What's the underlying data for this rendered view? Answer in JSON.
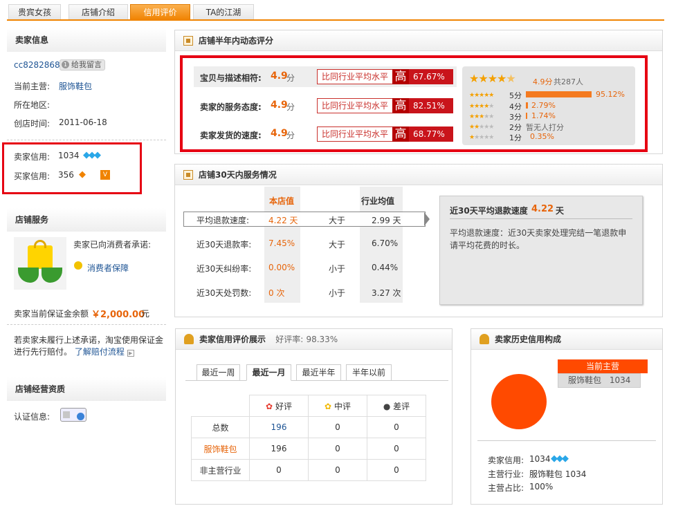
{
  "tabs": [
    "贵宾女孩",
    "店铺介绍",
    "信用评价",
    "TA的江湖"
  ],
  "seller_info": {
    "title": "卖家信息",
    "name": "cc8282868",
    "message_btn": "给我留言",
    "main_label": "当前主营:",
    "main_value": "服饰鞋包",
    "region_label": "所在地区:",
    "created_label": "创店时间:",
    "created_value": "2011-06-18",
    "seller_credit_label": "卖家信用:",
    "seller_credit_value": "1034",
    "buyer_credit_label": "买家信用:",
    "buyer_credit_value": "356"
  },
  "store_service": {
    "title": "店铺服务",
    "promise": "卖家已向消费者承诺:",
    "guarantee": "消费者保障",
    "deposit_label": "卖家当前保证金余额",
    "deposit_value": "￥2,000.00",
    "deposit_unit": "元",
    "note": "若卖家未履行上述承诺，淘宝使用保证金进行先行赔付。",
    "note_link": "了解赔付流程"
  },
  "qualification": {
    "title": "店铺经营资质",
    "label": "认证信息:"
  },
  "dsr": {
    "title": "店铺半年内动态评分",
    "rows": [
      {
        "label": "宝贝与描述相符:",
        "score": "4.9",
        "unit": "分",
        "cmp": "比同行业平均水平",
        "level": "高",
        "pct": "67.67%"
      },
      {
        "label": "卖家的服务态度:",
        "score": "4.9",
        "unit": "分",
        "cmp": "比同行业平均水平",
        "level": "高",
        "pct": "82.51%"
      },
      {
        "label": "卖家发货的速度:",
        "score": "4.9",
        "unit": "分",
        "cmp": "比同行业平均水平",
        "level": "高",
        "pct": "68.77%"
      }
    ],
    "summary_score": "4.9分",
    "summary_count": "共287人",
    "distribution": [
      {
        "label": "5分",
        "pct": "95.12%",
        "fill": 0.9512
      },
      {
        "label": "4分",
        "pct": "2.79%",
        "fill": 0.0279
      },
      {
        "label": "3分",
        "pct": "1.74%",
        "fill": 0.0174
      },
      {
        "label": "2分",
        "pct": "暂无人打分",
        "fill": 0
      },
      {
        "label": "1分",
        "pct": "0.35%",
        "fill": 0.0035
      }
    ]
  },
  "service30": {
    "title": "店铺30天内服务情况",
    "col_store": "本店值",
    "col_industry": "行业均值",
    "rows": [
      {
        "label": "平均退款速度:",
        "store": "4.22 天",
        "cmp": "大于",
        "industry": "2.99 天"
      },
      {
        "label": "近30天退款率:",
        "store": "7.45%",
        "cmp": "大于",
        "industry": "6.70%"
      },
      {
        "label": "近30天纠纷率:",
        "store": "0.00%",
        "cmp": "小于",
        "industry": "0.44%"
      },
      {
        "label": "近30天处罚数:",
        "store": "0 次",
        "cmp": "小于",
        "industry": "3.27 次"
      }
    ],
    "tip_title": "近30天平均退款速度",
    "tip_value": "4.22",
    "tip_unit": "天",
    "tip_desc": "平均退款速度：近30天卖家处理完结一笔退款申请平均花费的时长。"
  },
  "reviews": {
    "title": "卖家信用评价展示",
    "rate_label": "好评率:",
    "rate_value": "98.33%",
    "tabs": [
      "最近一周",
      "最近一月",
      "最近半年",
      "半年以前"
    ],
    "headers": [
      "好评",
      "中评",
      "差评"
    ],
    "rows": [
      {
        "label": "总数",
        "values": [
          "196",
          "0",
          "0"
        ]
      },
      {
        "label": "服饰鞋包",
        "values": [
          "196",
          "0",
          "0"
        ]
      },
      {
        "label": "非主营行业",
        "values": [
          "0",
          "0",
          "0"
        ]
      }
    ]
  },
  "history": {
    "title": "卖家历史信用构成",
    "tag": "当前主营",
    "category": "服饰鞋包",
    "category_value": "1034",
    "seller_credit_label": "卖家信用:",
    "seller_credit_value": "1034",
    "main_industry_label": "主营行业:",
    "main_industry_value": "服饰鞋包  1034",
    "ratio_label": "主营占比:",
    "ratio_value": "100%"
  },
  "colors": {
    "accent": "#f08300",
    "highlight_red": "#c9141b",
    "pie": "#ff4a00"
  }
}
